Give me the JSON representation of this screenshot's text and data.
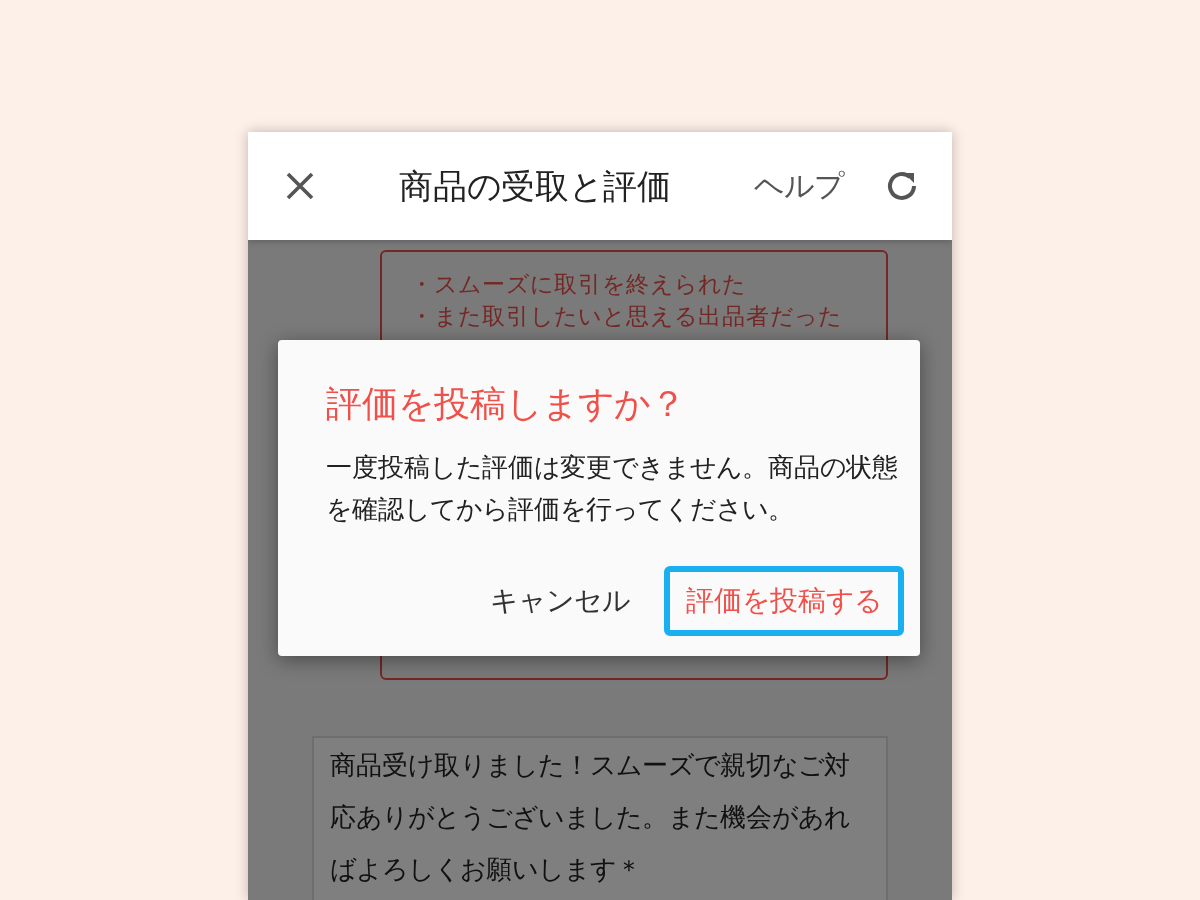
{
  "header": {
    "title": "商品の受取と評価",
    "help": "ヘルプ"
  },
  "checklist": [
    "・スムーズに取引を終えられた",
    "・また取引したいと思える出品者だった"
  ],
  "comment": "商品受け取りました！スムーズで親切なご対応ありがとうございました。また機会があればよろしくお願いします＊",
  "dialog": {
    "title": "評価を投稿しますか？",
    "message": "一度投稿した評価は変更できません。商品の状態を確認してから評価を行ってください。",
    "buttons": [
      {
        "label": "キャンセル",
        "kind": "cancel"
      },
      {
        "label": "評価を投稿する",
        "kind": "confirm"
      }
    ]
  }
}
